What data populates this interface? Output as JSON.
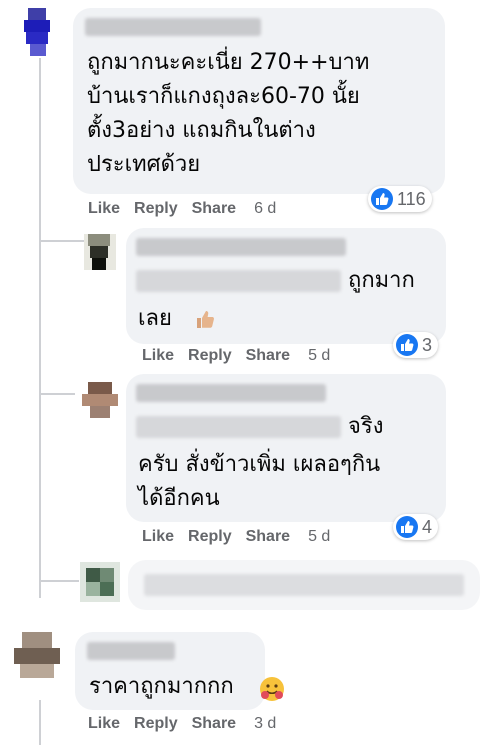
{
  "accent": "#1877f2",
  "comments": [
    {
      "id": "c1",
      "text": "ถูกมากนะคะเนี่ย 270++บาท\nบ้านเราก็แกงถุงละ60-70 นั้ย\nตั้ง3อย่าง แถมกินในต่าง\nประเทศด้วย",
      "actions": {
        "like": "Like",
        "reply": "Reply",
        "share": "Share",
        "time": "6 d"
      },
      "reaction": {
        "icon": "thumbs-up-icon",
        "count": "116"
      }
    },
    {
      "id": "r1",
      "text_end": "ถูกมาก",
      "text_rest": "เลย",
      "emoji": "thumbs-up-emoji",
      "actions": {
        "like": "Like",
        "reply": "Reply",
        "share": "Share",
        "time": "5 d"
      },
      "reaction": {
        "icon": "thumbs-up-icon",
        "count": "3"
      }
    },
    {
      "id": "r2",
      "text_end": "จริง",
      "text_rest": "ครับ สั่งข้าวเพิ่ม เผลอๆกิน\nได้อีกคน",
      "actions": {
        "like": "Like",
        "reply": "Reply",
        "share": "Share",
        "time": "5 d"
      },
      "reaction": {
        "icon": "thumbs-up-icon",
        "count": "4"
      }
    },
    {
      "id": "c2",
      "text": "ราคาถูกมากกก",
      "emoji": "hugging-emoji",
      "actions": {
        "like": "Like",
        "reply": "Reply",
        "share": "Share",
        "time": "3 d"
      }
    }
  ]
}
